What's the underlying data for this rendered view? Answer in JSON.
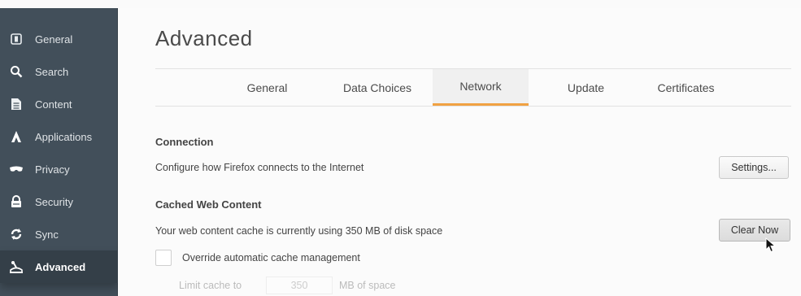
{
  "sidebar": {
    "items": [
      {
        "label": "General",
        "icon": "general-icon"
      },
      {
        "label": "Search",
        "icon": "search-icon"
      },
      {
        "label": "Content",
        "icon": "content-icon"
      },
      {
        "label": "Applications",
        "icon": "applications-icon"
      },
      {
        "label": "Privacy",
        "icon": "privacy-icon"
      },
      {
        "label": "Security",
        "icon": "security-icon"
      },
      {
        "label": "Sync",
        "icon": "sync-icon"
      },
      {
        "label": "Advanced",
        "icon": "advanced-icon",
        "active": true
      }
    ]
  },
  "main": {
    "title": "Advanced",
    "tabs": [
      {
        "label": "General"
      },
      {
        "label": "Data Choices"
      },
      {
        "label": "Network",
        "active": true
      },
      {
        "label": "Update"
      },
      {
        "label": "Certificates"
      }
    ],
    "connection": {
      "heading": "Connection",
      "description": "Configure how Firefox connects to the Internet",
      "settings_button": "Settings..."
    },
    "cache": {
      "heading": "Cached Web Content",
      "description": "Your web content cache is currently using 350 MB of disk space",
      "clear_button": "Clear Now",
      "override_label": "Override automatic cache management",
      "limit_label": "Limit cache to",
      "limit_value": "350",
      "limit_unit": "MB of space"
    }
  },
  "colors": {
    "sidebar_bg": "#424f5a",
    "active_tab_accent": "#f0a142"
  }
}
